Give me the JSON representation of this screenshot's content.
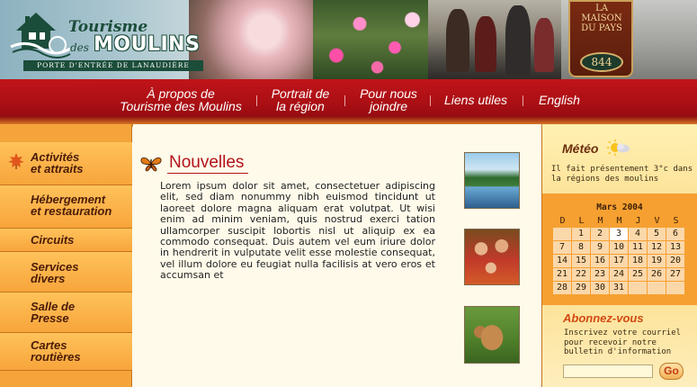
{
  "header": {
    "logo": {
      "title_top": "Tourisme",
      "title_des": "des",
      "title_bottom": "MOULINS",
      "tagline": "PORTE D'ENTRÉE DE LANAUDIÈRE"
    },
    "sign": {
      "text": "LA MAISON DU PAYS",
      "number": "844"
    }
  },
  "nav": {
    "items": [
      {
        "line1": "À propos de",
        "line2": "Tourisme des Moulins"
      },
      {
        "line1": "Portrait de",
        "line2": "la région"
      },
      {
        "line1": "Pour nous",
        "line2": "joindre"
      },
      {
        "line1": "Liens utiles",
        "line2": ""
      },
      {
        "line1": "English",
        "line2": ""
      }
    ]
  },
  "left_menu": {
    "items": [
      {
        "line1": "Activités",
        "line2": "et attraits"
      },
      {
        "line1": "Hébergement",
        "line2": "et restauration"
      },
      {
        "line1": "Circuits",
        "line2": ""
      },
      {
        "line1": "Services",
        "line2": "divers"
      },
      {
        "line1": "Salle de",
        "line2": "Presse"
      },
      {
        "line1": "Cartes",
        "line2": "routières"
      }
    ]
  },
  "main": {
    "title": "Nouvelles",
    "body": "Lorem ipsum dolor sit amet, consectetuer adipiscing elit, sed diam nonummy nibh euismod tincidunt ut laoreet dolore magna aliquam erat volutpat. Ut wisi enim ad minim veniam, quis nostrud exerci tation ullamcorper suscipit lobortis nisl ut aliquip ex ea commodo consequat. Duis autem vel eum iriure dolor in hendrerit in vulputate velit esse molestie consequat, vel illum dolore eu feugiat nulla facilisis at vero eros et accumsan et"
  },
  "meteo": {
    "title": "Météo",
    "text": "Il fait présentement 3°c dans la régions des moulins"
  },
  "calendar": {
    "title": "Mars 2004",
    "days_of_week": [
      "D",
      "L",
      "M",
      "M",
      "J",
      "V",
      "S"
    ],
    "weeks": [
      [
        "",
        "1",
        "2",
        "3",
        "4",
        "5",
        "6"
      ],
      [
        "7",
        "8",
        "9",
        "10",
        "11",
        "12",
        "13"
      ],
      [
        "14",
        "15",
        "16",
        "17",
        "18",
        "19",
        "20"
      ],
      [
        "21",
        "22",
        "23",
        "24",
        "25",
        "26",
        "27"
      ],
      [
        "28",
        "29",
        "30",
        "31",
        "",
        "",
        ""
      ]
    ],
    "today": "3"
  },
  "newsletter": {
    "title": "Abonnez-vous",
    "text": "Inscrivez votre courriel pour recevoir notre bulletin d'information",
    "input_value": "",
    "button_label": "Go"
  },
  "colors": {
    "nav_red": "#b3121a",
    "menu_orange": "#f7a53b",
    "content_bg": "#fffaea"
  }
}
